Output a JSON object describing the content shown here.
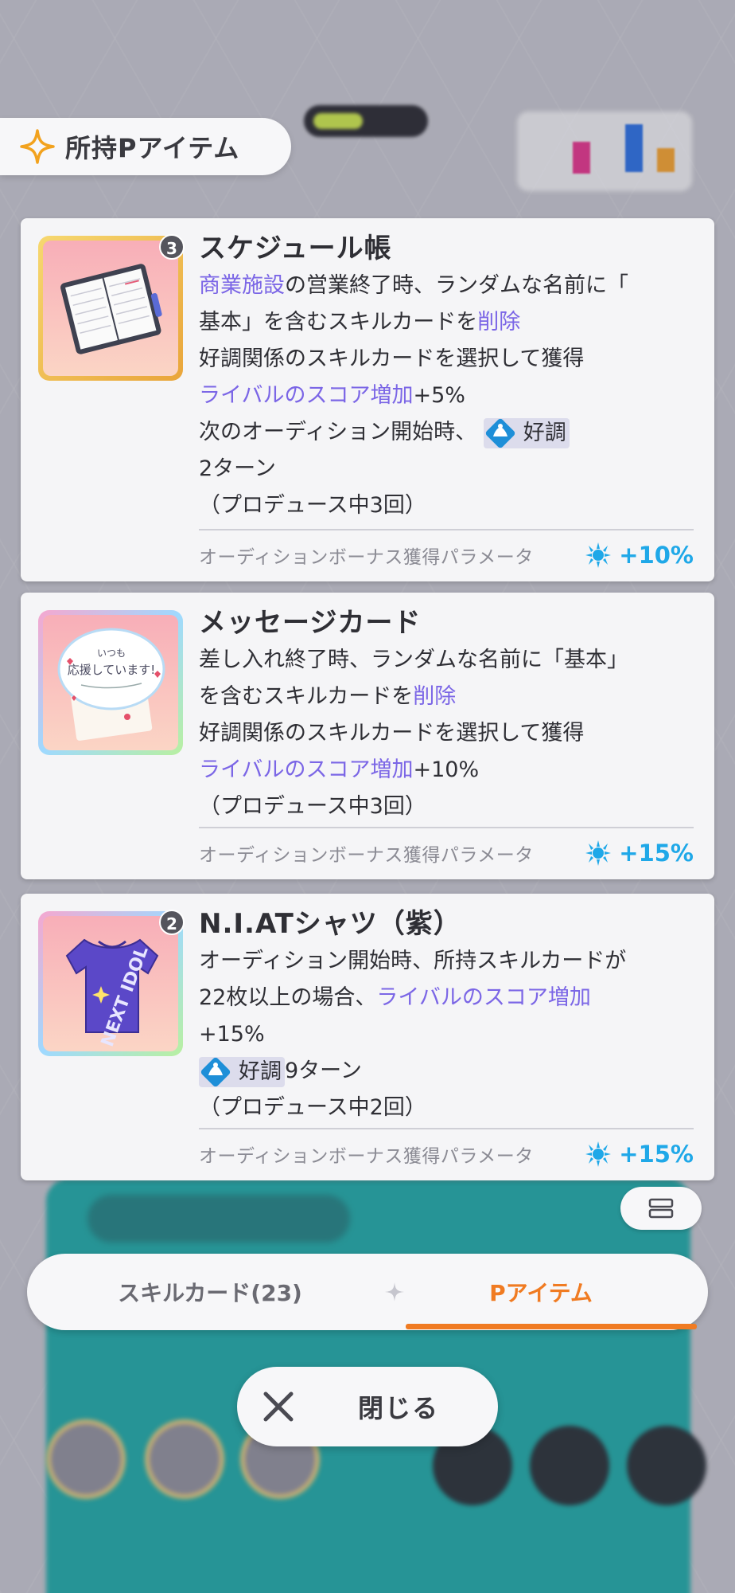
{
  "header": {
    "title": "所持Pアイテム",
    "icon": "sparkle-icon"
  },
  "items": [
    {
      "name": "スケジュール帳",
      "count": "3",
      "icon": "schedule-book-icon",
      "frame": "gold",
      "desc": {
        "l1a": "商業施設",
        "l1b": "の営業終了時、ランダムな名前に「",
        "l2a": "基本」を含むスキルカードを",
        "l2b": "削除",
        "l3": "好調関係のスキルカードを選択して獲得",
        "l4a": "ライバルのスコア増加",
        "l4b": "+5%",
        "l5a": "次のオーディション開始時、",
        "l5buff": "好調",
        "l6": "2ターン",
        "l7": "（プロデュース中3回）"
      },
      "bonus_label": "オーディションボーナス獲得パラメータ",
      "bonus_value": "+10%"
    },
    {
      "name": "メッセージカード",
      "icon": "message-card-icon",
      "frame": "rainbow",
      "desc": {
        "l1": "差し入れ終了時、ランダムな名前に「基本」",
        "l2a": "を含むスキルカードを",
        "l2b": "削除",
        "l3": "好調関係のスキルカードを選択して獲得",
        "l4a": "ライバルのスコア増加",
        "l4b": "+10%",
        "l5": "（プロデュース中3回）"
      },
      "card_text": {
        "line1": "いつも",
        "line2": "応援しています!"
      },
      "bonus_label": "オーディションボーナス獲得パラメータ",
      "bonus_value": "+15%"
    },
    {
      "name": "N.I.ATシャツ（紫）",
      "count": "2",
      "icon": "tshirt-icon",
      "frame": "rainbow",
      "desc": {
        "l1": "オーディション開始時、所持スキルカードが",
        "l2a": "22枚以上の場合、",
        "l2b": "ライバルのスコア増加",
        "l3": "+15%",
        "l4buff": "好調",
        "l4b": "9ターン",
        "l5": "（プロデュース中2回）"
      },
      "shirt_text": "NEXT IDOL",
      "bonus_label": "オーディションボーナス獲得パラメータ",
      "bonus_value": "+15%"
    }
  ],
  "tabs": [
    {
      "label": "スキルカード(23)",
      "active": false
    },
    {
      "label": "Pアイテム",
      "active": true
    }
  ],
  "close_button": {
    "label": "閉じる",
    "icon": "close-icon"
  },
  "view_toggle": {
    "icon": "list-view-icon"
  },
  "colors": {
    "highlight": "#7b66e6",
    "bonus": "#1fa8e8",
    "active_tab": "#f07b22",
    "buff": "#1e8fd8"
  }
}
